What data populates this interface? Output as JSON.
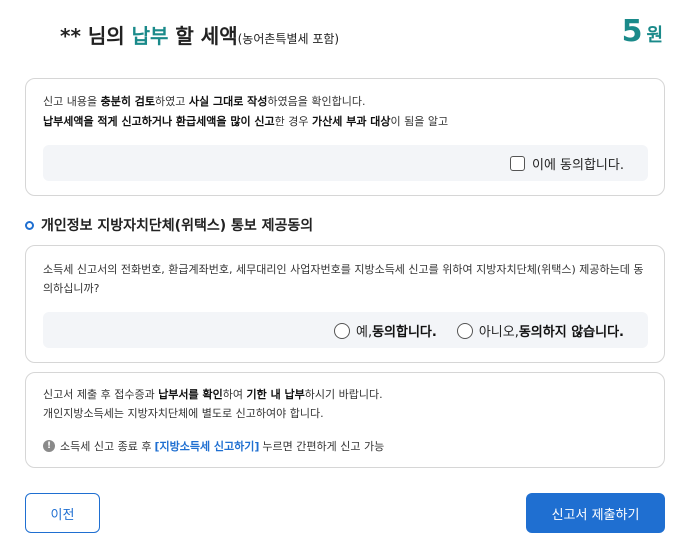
{
  "header": {
    "title_prefix": "** 님의 ",
    "title_accent": "납부",
    "title_rest": " 할 세액",
    "title_sub": "(농어촌특별세 포함)",
    "amount": "5",
    "amount_unit": "원"
  },
  "confirm_card": {
    "line1_a": "신고 내용을 ",
    "line1_b": "충분히 검토",
    "line1_c": "하였고 ",
    "line1_d": "사실 그대로 작성",
    "line1_e": "하였음을 확인합니다.",
    "line2_a": "납부세액을 적게 신고하거나 환급세액을 많이 신고",
    "line2_b": "한 경우 ",
    "line2_c": "가산세 부과 대상",
    "line2_d": "이 됨을 알고",
    "checkbox_label": "이에 동의합니다."
  },
  "privacy_section": {
    "title": "개인정보 지방자치단체(위택스) 통보 제공동의",
    "description": "소득세 신고서의 전화번호, 환급계좌번호, 세무대리인 사업자번호를 지방소득세 신고를 위하여 지방자치단체(위택스) 제공하는데 동의하십니까?",
    "yes_prefix": "예, ",
    "yes_label": "동의합니다.",
    "no_prefix": "아니오, ",
    "no_label": "동의하지 않습니다."
  },
  "info_card": {
    "line1_a": "신고서 제출 후 접수증과 ",
    "line1_b": "납부서를 확인",
    "line1_c": "하여 ",
    "line1_d": "기한 내 납부",
    "line1_e": "하시기 바랍니다.",
    "line2": "개인지방소득세는 지방자치단체에 별도로 신고하여야 합니다.",
    "notice_icon": "!",
    "notice_a": "소득세 신고 종료 후",
    "notice_link": "[지방소득세 신고하기]",
    "notice_b": "누르면 간편하게 신고 가능"
  },
  "buttons": {
    "prev": "이전",
    "submit": "신고서 제출하기"
  },
  "colors": {
    "accent_teal": "#1a8a8a",
    "primary_blue": "#1f6fd1"
  }
}
